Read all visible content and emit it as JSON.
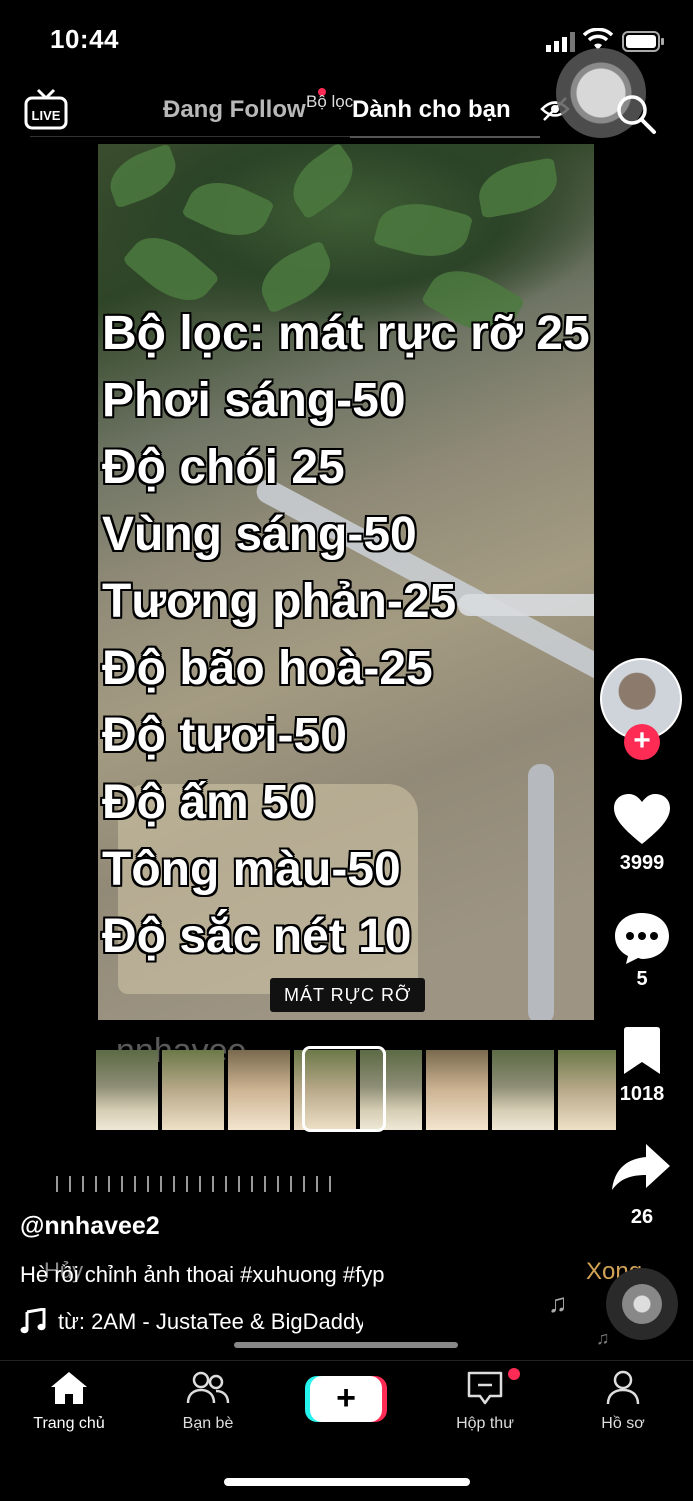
{
  "status_bar": {
    "time": "10:44"
  },
  "top_nav": {
    "live_label": "LIVE",
    "tab_following": "Đang Follow",
    "tab_overlay": "Bộ lọc",
    "tab_for_you": "Dành cho bạn"
  },
  "video": {
    "caption_lines": [
      "Bộ lọc: mát rực rỡ 25",
      "Phơi sáng-50",
      "Độ chói 25",
      "Vùng sáng-50",
      "Tương phản-25",
      "Độ bão hoà-25",
      "Độ tươi-50",
      "Độ ấm 50",
      "Tông màu-50",
      "Độ sắc nét 10"
    ],
    "filter_name": "MÁT RỰC RỠ",
    "watermark": "nnhavee"
  },
  "actions": {
    "likes": "3999",
    "comments": "5",
    "saves": "1018",
    "shares": "26"
  },
  "post": {
    "username": "@nnhavee2",
    "description": "Hè rồi chỉnh ảnh thoai #xuhuong #fyp",
    "edit_cancel": "Hủy",
    "edit_done": "Xong",
    "sound": "từ: 2AM - JustaTee & BigDaddy"
  },
  "bottom_nav": {
    "home": "Trang chủ",
    "friends": "Bạn bè",
    "create": "+",
    "inbox": "Hộp thư",
    "profile": "Hồ sơ"
  },
  "colors": {
    "accent": "#fe2c55",
    "cyan": "#25f4ee",
    "done": "#d2a356"
  }
}
